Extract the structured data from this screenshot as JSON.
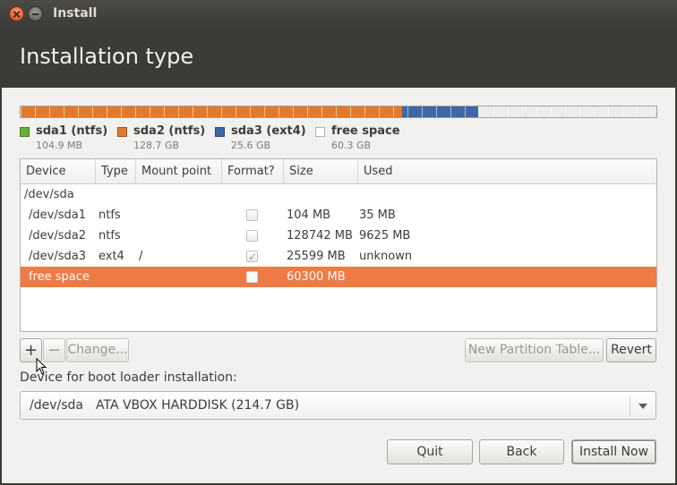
{
  "window": {
    "title": "Install"
  },
  "header": {
    "title": "Installation type"
  },
  "partition_bar": {
    "segments": [
      {
        "name": "sda1 (ntfs)",
        "fraction": 0.0005,
        "color": "#d6d6d6"
      },
      {
        "name": "sda2 (ntfs)",
        "fraction": 0.5997,
        "color": "#e07a2e"
      },
      {
        "name": "sda3 (ext4)",
        "fraction": 0.1192,
        "color": "#3d67a5"
      },
      {
        "name": "free space",
        "fraction": 0.2806,
        "color": "#ececec"
      }
    ]
  },
  "legend": [
    {
      "label": "sda1 (ntfs)",
      "size": "104.9 MB",
      "color": "#6ab13c"
    },
    {
      "label": "sda2 (ntfs)",
      "size": "128.7 GB",
      "color": "#e07a2e"
    },
    {
      "label": "sda3 (ext4)",
      "size": "25.6 GB",
      "color": "#3d67a5"
    },
    {
      "label": "free space",
      "size": "60.3 GB",
      "color": "#ffffff"
    }
  ],
  "table": {
    "headers": [
      "Device",
      "Type",
      "Mount point",
      "Format?",
      "Size",
      "Used"
    ],
    "rows": [
      {
        "device": "/dev/sda",
        "type": "",
        "mount": "",
        "format": null,
        "size": "",
        "used": "",
        "selected": false
      },
      {
        "device": "/dev/sda1",
        "type": "ntfs",
        "mount": "",
        "format": false,
        "size": "104 MB",
        "used": "35 MB",
        "selected": false
      },
      {
        "device": "/dev/sda2",
        "type": "ntfs",
        "mount": "",
        "format": false,
        "size": "128742 MB",
        "used": "9625 MB",
        "selected": false
      },
      {
        "device": "/dev/sda3",
        "type": "ext4",
        "mount": "/",
        "format": true,
        "size": "25599 MB",
        "used": "unknown",
        "selected": false
      },
      {
        "device": "free space",
        "type": "",
        "mount": "",
        "format": false,
        "size": "60300 MB",
        "used": "",
        "selected": true
      }
    ]
  },
  "toolbar": {
    "add_label": "+",
    "remove_label": "−",
    "change_label": "Change...",
    "new_table_label": "New Partition Table...",
    "revert_label": "Revert"
  },
  "bootloader": {
    "label": "Device for boot loader installation:",
    "device": "/dev/sda",
    "description": "ATA VBOX HARDDISK (214.7 GB)"
  },
  "footer": {
    "quit_label": "Quit",
    "back_label": "Back",
    "install_label": "Install Now"
  }
}
